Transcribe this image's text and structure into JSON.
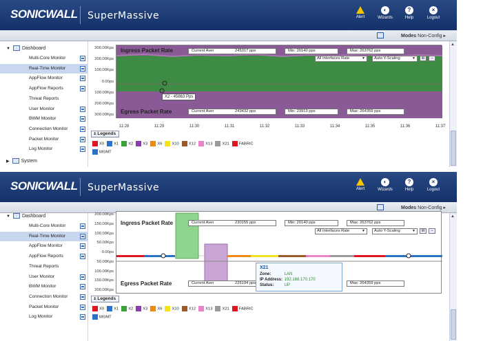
{
  "app": {
    "brand": "SONICWALL",
    "product": "SuperMassive",
    "buttons": [
      {
        "label": "Alert",
        "icon": "alert-icon"
      },
      {
        "label": "Wizards",
        "icon": "wizard-icon"
      },
      {
        "label": "Help",
        "icon": "help-icon"
      },
      {
        "label": "Logout",
        "icon": "logout-icon"
      }
    ],
    "modes_label": "Modes",
    "modes_value": "Non-Config"
  },
  "sidebar": {
    "dashboard": "Dashboard",
    "items": [
      {
        "label": "Multi-Core Monitor",
        "selected": false,
        "icon": true
      },
      {
        "label": "Real-Time Monitor",
        "selected": true,
        "icon": true
      },
      {
        "label": "AppFlow Monitor",
        "selected": false,
        "icon": true
      },
      {
        "label": "AppFlow Reports",
        "selected": false,
        "icon": true
      },
      {
        "label": "Threat Reports",
        "selected": false,
        "icon": false
      },
      {
        "label": "User Monitor",
        "selected": false,
        "icon": true
      },
      {
        "label": "BWM Monitor",
        "selected": false,
        "icon": true
      },
      {
        "label": "Connection Monitor",
        "selected": false,
        "icon": true
      },
      {
        "label": "Packet Monitor",
        "selected": false,
        "icon": true
      },
      {
        "label": "Log Monitor",
        "selected": false,
        "icon": true
      }
    ],
    "system": "System"
  },
  "chart1": {
    "yticks": [
      "300.00Kps",
      "200.00Kps",
      "100.00Kps",
      "0.00ps",
      "100.00Kps",
      "200.00Kps",
      "300.00Kps"
    ],
    "xticks": [
      "11:28",
      "11:29",
      "11:30",
      "11:31",
      "11:32",
      "11:33",
      "11:34",
      "11:35",
      "11:36",
      "11:37"
    ],
    "ingress_title": "Ingress Packet Rate",
    "egress_title": "Egress Packet Rate",
    "ingress": {
      "current_label": "Current Aver",
      "current": "245317 pps",
      "min_label": "Min:",
      "min": "20140 pps",
      "max_label": "Max:",
      "max": "263762 pps"
    },
    "egress": {
      "current_label": "Current Aver",
      "current": "243432 pps",
      "min_label": "Min:",
      "min": "23913 pps",
      "max_label": "Max:",
      "max": "264359 pps"
    },
    "interface_select": "All Interfaces Rate",
    "scaling_select": "Auto Y-Scaling",
    "tooltip": "X2 - 45863 Pps"
  },
  "chart2": {
    "yticks": [
      "200.00Kps",
      "150.00Kps",
      "100.00Kps",
      "50.00Kps",
      "0.00ps",
      "50.00Kps",
      "100.00Kps",
      "150.00Kps",
      "200.00Kps"
    ],
    "ingress_title": "Ingress Packet Rate",
    "egress_title": "Egress Packet Rate",
    "ingress": {
      "current_label": "Current Aver",
      "current": "230155 pps",
      "min_label": "Min:",
      "min": "20140 pps",
      "max_label": "Max:",
      "max": "263762 pps"
    },
    "egress": {
      "current_label": "Current Aver",
      "current": "226194 pps",
      "min_label": "Min:",
      "min": "",
      "max_label": "Max:",
      "max": "264359 pps"
    },
    "interface_select": "All Interfaces Rate",
    "scaling_select": "Auto Y-Scaling",
    "popup": {
      "title": "X21",
      "zone_label": "Zone:",
      "zone": "LAN",
      "ip_label": "IP Address:",
      "ip": "192.168.170.170",
      "status_label": "Status:",
      "status": "UP"
    }
  },
  "legend": {
    "button": "Legends",
    "items": [
      {
        "label": "X0",
        "color": "#e0141e"
      },
      {
        "label": "X1",
        "color": "#2a72c4"
      },
      {
        "label": "X2",
        "color": "#3aa43a"
      },
      {
        "label": "X3",
        "color": "#8a3ea6"
      },
      {
        "label": "X6",
        "color": "#f08a14"
      },
      {
        "label": "X10",
        "color": "#f4e21c"
      },
      {
        "label": "X12",
        "color": "#9a5a2a"
      },
      {
        "label": "X13",
        "color": "#ee82c8"
      },
      {
        "label": "X21",
        "color": "#9a9a9a"
      },
      {
        "label": "FABRIC",
        "color": "#e0141e"
      }
    ],
    "extra": {
      "label": "MGMT",
      "color": "#2a72c4"
    }
  }
}
